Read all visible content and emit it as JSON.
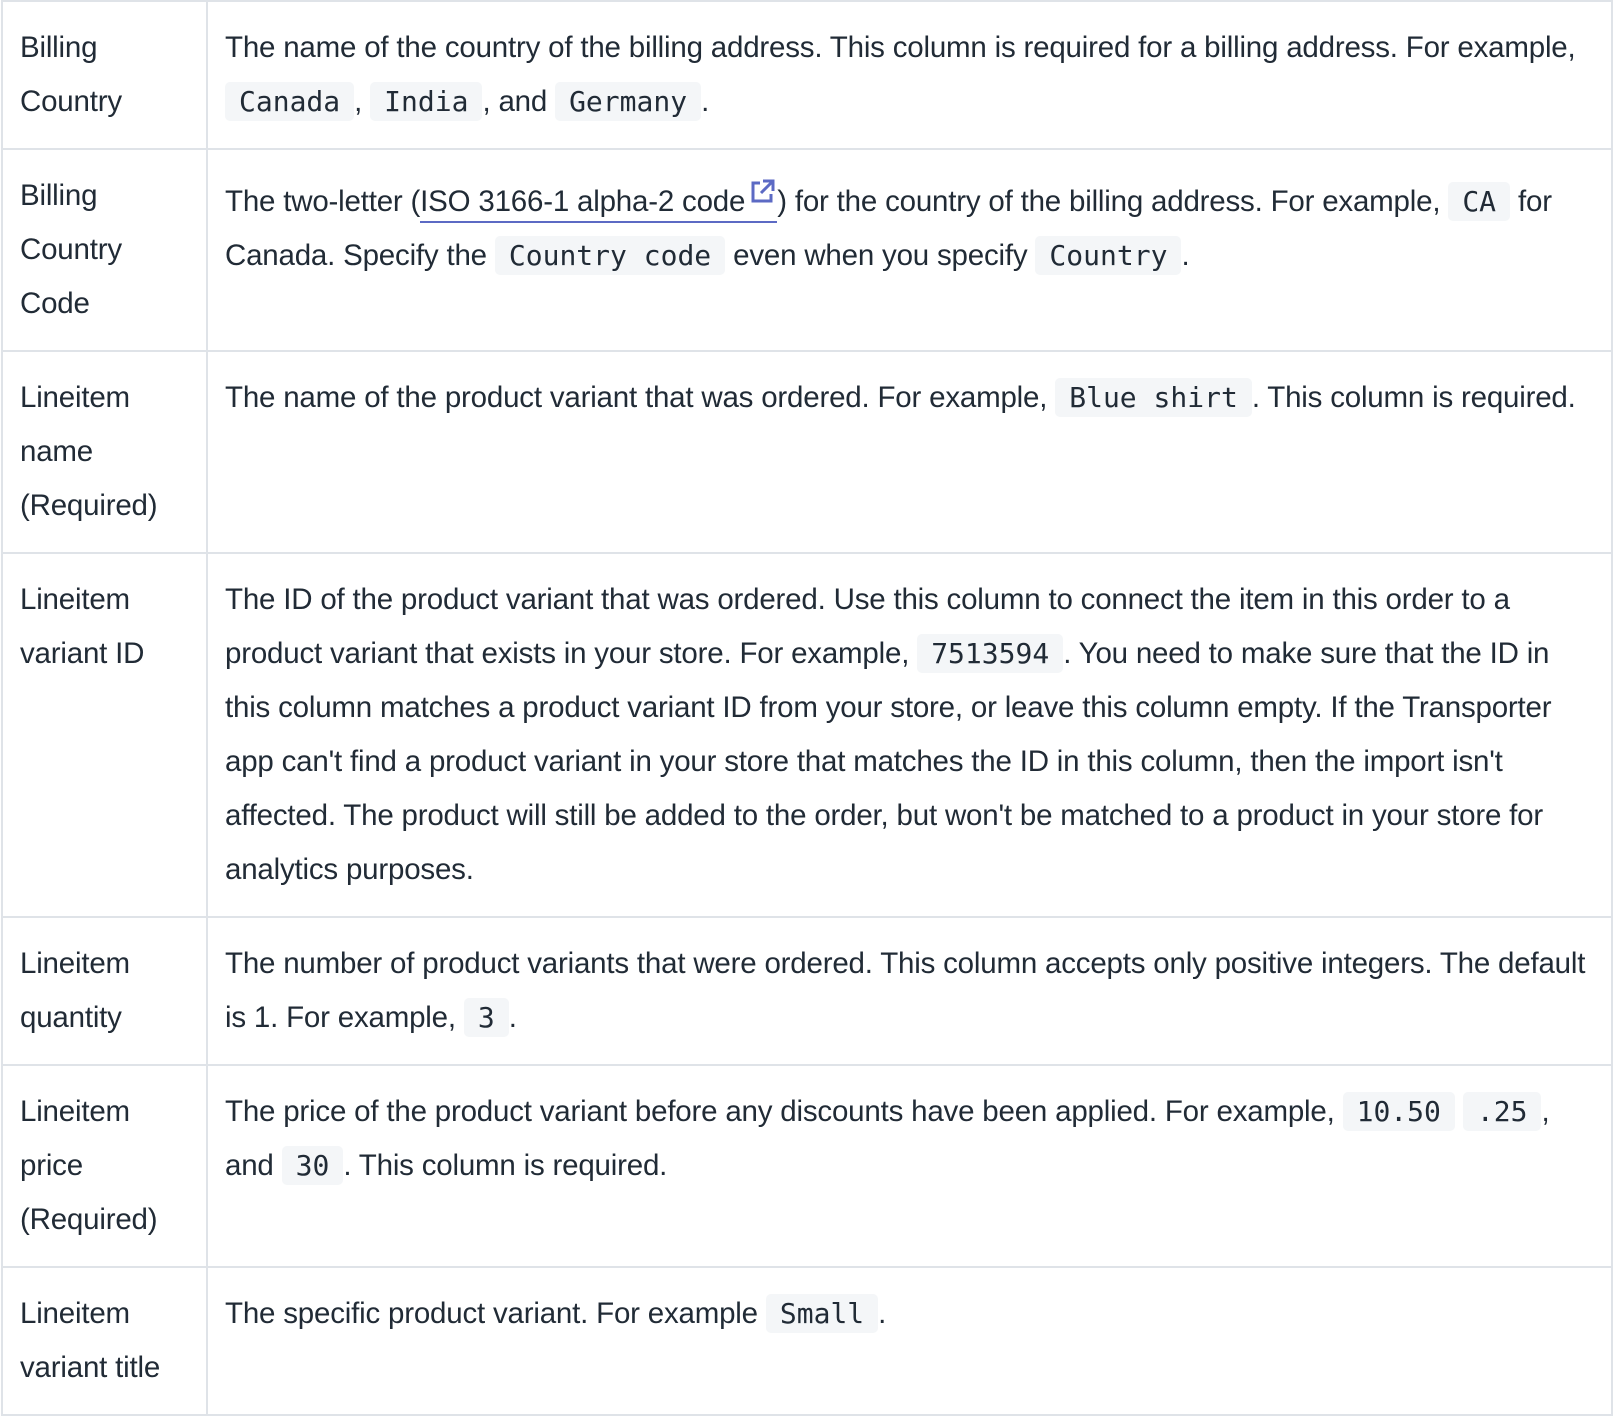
{
  "colors": {
    "text": "#212b36",
    "border": "#dfe3e8",
    "code_bg": "#f4f6f8",
    "link_accent": "#5c6ac4"
  },
  "rows": [
    {
      "name": "Billing Country",
      "desc": {
        "t1": "The name of the country of the billing address. This column is required for a billing address. For example, ",
        "c1": "Canada",
        "t2": ", ",
        "c2": "India",
        "t3": ", and ",
        "c3": "Germany",
        "t4": "."
      }
    },
    {
      "name": "Billing Country Code",
      "desc": {
        "t1": "The two-letter (",
        "link": "ISO 3166-1 alpha-2 code",
        "link_icon": "external-link-icon",
        "t2": ") for the country of the billing address. For example, ",
        "c1": "CA",
        "t3": " for Canada. Specify the ",
        "c2": "Country code",
        "t4": " even when you specify ",
        "c3": "Country",
        "t5": "."
      }
    },
    {
      "name": "Lineitem name (Required)",
      "desc": {
        "t1": "The name of the product variant that was ordered. For example, ",
        "c1": "Blue shirt",
        "t2": ". This column is required."
      }
    },
    {
      "name": "Lineitem variant ID",
      "desc": {
        "t1": "The ID of the product variant that was ordered. Use this column to connect the item in this order to a product variant that exists in your store. For example, ",
        "c1": "7513594",
        "t2": ". You need to make sure that the ID in this column matches a product variant ID from your store, or leave this column empty. If the Transporter app can't find a product variant in your store that matches the ID in this column, then the import isn't affected. The product will still be added to the order, but won't be matched to a product in your store for analytics purposes."
      }
    },
    {
      "name": "Lineitem quantity",
      "desc": {
        "t1": "The number of product variants that were ordered. This column accepts only positive integers. The default is 1. For example, ",
        "c1": "3",
        "t2": "."
      }
    },
    {
      "name": "Lineitem price (Required)",
      "desc": {
        "t1": "The price of the product variant before any discounts have been applied. For example, ",
        "c1": "10.50",
        "t2": " ",
        "c2": ".25",
        "t3": ", and ",
        "c3": "30",
        "t4": ". This column is required."
      }
    },
    {
      "name": "Lineitem variant title",
      "desc": {
        "t1": "The specific product variant. For example ",
        "c1": "Small",
        "t2": "."
      }
    }
  ]
}
